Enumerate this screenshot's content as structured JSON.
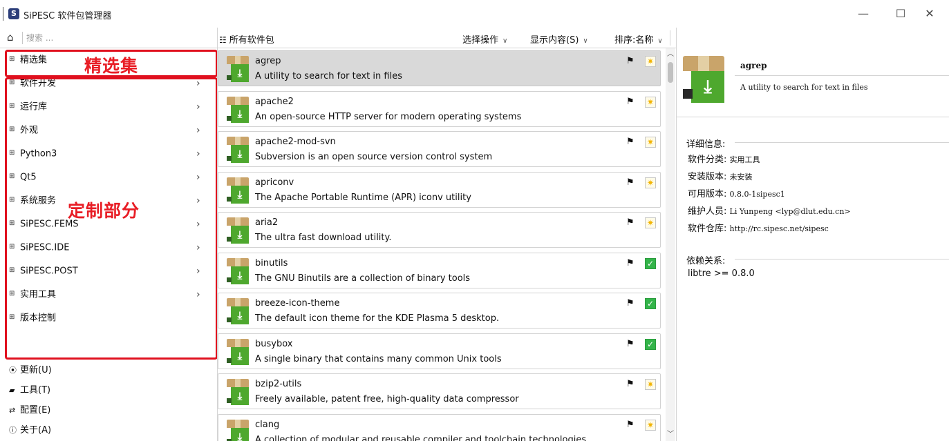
{
  "window": {
    "title": "SiPESC 软件包管理器",
    "app_icon": "S",
    "controls": {
      "minimize": "—",
      "maximize": "☐",
      "close": "✕"
    }
  },
  "left_panel": {
    "search": {
      "placeholder": "搜索 ...",
      "value": ""
    },
    "categories": [
      {
        "label": "精选集",
        "has_children": false
      },
      {
        "label": "软件开发",
        "has_children": true
      },
      {
        "label": "运行库",
        "has_children": true
      },
      {
        "label": "外观",
        "has_children": true
      },
      {
        "label": "Python3",
        "has_children": true
      },
      {
        "label": "Qt5",
        "has_children": true
      },
      {
        "label": "系统服务",
        "has_children": true
      },
      {
        "label": "SiPESC.FEMS",
        "has_children": true
      },
      {
        "label": "SiPESC.IDE",
        "has_children": true
      },
      {
        "label": "SiPESC.POST",
        "has_children": true
      },
      {
        "label": "实用工具",
        "has_children": true
      },
      {
        "label": "版本控制",
        "has_children": false
      }
    ],
    "annotations": {
      "featured": "精选集",
      "custom": "定制部分"
    },
    "actions": [
      {
        "icon": "update-icon",
        "label": "更新(U)"
      },
      {
        "icon": "toolbox-icon",
        "label": "工具(T)"
      },
      {
        "icon": "sliders-icon",
        "label": "配置(E)"
      },
      {
        "icon": "info-icon",
        "label": "关于(A)"
      }
    ]
  },
  "middle_panel": {
    "title": "所有软件包",
    "menus": {
      "select_ops": "选择操作",
      "display_content": "显示内容(S)",
      "sort": "排序:名称"
    },
    "packages": [
      {
        "name": "agrep",
        "description": "A utility to search for text in files",
        "status": "available",
        "selected": true
      },
      {
        "name": "apache2",
        "description": "An open-source HTTP server for modern operating systems",
        "status": "available",
        "selected": false
      },
      {
        "name": "apache2-mod-svn",
        "description": "Subversion is an open source version control system",
        "status": "available",
        "selected": false
      },
      {
        "name": "apriconv",
        "description": "The Apache Portable Runtime (APR) iconv utility",
        "status": "available",
        "selected": false
      },
      {
        "name": "aria2",
        "description": "The ultra fast download utility.",
        "status": "available",
        "selected": false
      },
      {
        "name": "binutils",
        "description": "The GNU Binutils are a collection of binary tools",
        "status": "installed",
        "selected": false
      },
      {
        "name": "breeze-icon-theme",
        "description": "The default icon theme for the KDE Plasma 5 desktop.",
        "status": "installed",
        "selected": false
      },
      {
        "name": "busybox",
        "description": "A single binary that contains many common Unix tools",
        "status": "installed",
        "selected": false
      },
      {
        "name": "bzip2-utils",
        "description": "Freely available, patent free, high-quality data compressor",
        "status": "available",
        "selected": false
      },
      {
        "name": "clang",
        "description": "A collection of modular and reusable compiler and toolchain technologies",
        "status": "available",
        "selected": false
      }
    ]
  },
  "detail_panel": {
    "name": "agrep",
    "summary": "A utility to search for text in files",
    "details_title": "详细信息:",
    "details": [
      {
        "key": "软件分类:",
        "value": "实用工具"
      },
      {
        "key": "安装版本:",
        "value": "未安装"
      },
      {
        "key": "可用版本:",
        "value": "0.8.0-1sipesc1"
      },
      {
        "key": "维护人员:",
        "value": "Li Yunpeng <lyp@dlut.edu.cn>"
      },
      {
        "key": "软件仓库:",
        "value": "http://rc.sipesc.net/sipesc"
      }
    ],
    "deps_title": "依赖关系:",
    "dependencies": [
      "libtre >= 0.8.0"
    ]
  },
  "colors": {
    "highlight_red": "#e0101e",
    "package_green": "#4ea82e",
    "installed_green": "#34b44a",
    "selected_row": "#d9d9d9"
  }
}
